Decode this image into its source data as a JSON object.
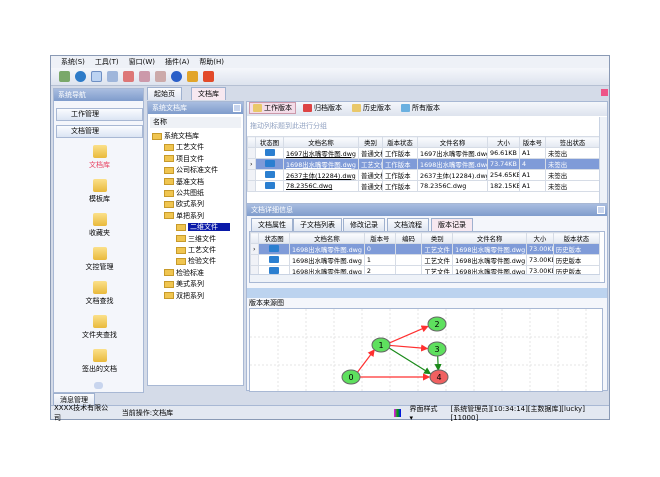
{
  "menu": [
    "系统(S)",
    "工具(T)",
    "窗口(W)",
    "插件(A)",
    "帮助(H)"
  ],
  "toolbar_icons": [
    "new-icon",
    "globe-icon",
    "window-icon",
    "layout-icon",
    "doc-red-icon",
    "doc-blue-icon",
    "doc-check-icon",
    "help-icon",
    "lock-icon",
    "power-icon"
  ],
  "nav": {
    "title": "系统导航",
    "groups": [
      "工作管理",
      "文档管理"
    ],
    "items": [
      {
        "label": "文档库",
        "active": true
      },
      {
        "label": "模板库"
      },
      {
        "label": "收藏夹"
      },
      {
        "label": "文控管理"
      },
      {
        "label": "文档查找"
      },
      {
        "label": "文件夹查找"
      },
      {
        "label": "签出的文档"
      }
    ]
  },
  "doc_tabs": [
    "起始页",
    "文档库"
  ],
  "tree": {
    "title": "系统文档库",
    "column": "名称",
    "nodes": [
      {
        "label": "系统文档库",
        "level": 0
      },
      {
        "label": "工艺文件",
        "level": 1
      },
      {
        "label": "项目文件",
        "level": 1
      },
      {
        "label": "公司标准文件",
        "level": 1
      },
      {
        "label": "基准文档",
        "level": 1
      },
      {
        "label": "公共图纸",
        "level": 1
      },
      {
        "label": "欧式系列",
        "level": 1
      },
      {
        "label": "单把系列",
        "level": 1
      },
      {
        "label": "二维文件",
        "level": 2,
        "selected": true
      },
      {
        "label": "三维文件",
        "level": 2
      },
      {
        "label": "工艺文件",
        "level": 2
      },
      {
        "label": "检验文件",
        "level": 2
      },
      {
        "label": "检验标准",
        "level": 1
      },
      {
        "label": "美式系列",
        "level": 1
      },
      {
        "label": "双把系列",
        "level": 1
      }
    ]
  },
  "version_toolbar": [
    "工作版本",
    "归档版本",
    "历史版本",
    "所有版本"
  ],
  "group_hint": "拖动列标题到此进行分组",
  "main_grid": {
    "columns": [
      "状态图",
      "文档名称",
      "类别",
      "版本状态",
      "文件名称",
      "大小",
      "版本号",
      "签出状态"
    ],
    "rows": [
      [
        "",
        "1697出水嘴零件图.dwg",
        "普通文档",
        "工作版本",
        "1697出水嘴零件图.dwg",
        "96.61KB",
        "A1",
        "未签出"
      ],
      [
        "",
        "1698出水嘴零件图.dwg",
        "工艺文件",
        "工作版本",
        "1698出水嘴零件图.dwg",
        "73.74KB",
        "4",
        "未签出"
      ],
      [
        "",
        "2637主体(12284).dwg",
        "普通文档",
        "工作版本",
        "2637主体(12284).dwg",
        "254.65KB",
        "A1",
        "未签出"
      ],
      [
        "",
        "78.2356C.dwg",
        "普通文档",
        "工作版本",
        "78.2356C.dwg",
        "182.15KB",
        "A1",
        "未签出"
      ]
    ],
    "selected": 1
  },
  "detail": {
    "title": "文档详细信息",
    "tabs": [
      "文档属性",
      "子文档列表",
      "修改记录",
      "文档流程",
      "版本记录"
    ],
    "active_tab": 4,
    "columns": [
      "状态图",
      "文档名称",
      "版本号",
      "编码",
      "类别",
      "文件名称",
      "大小",
      "版本状态"
    ],
    "rows": [
      [
        "",
        "1698出水嘴零件图.dwg",
        "0",
        "",
        "工艺文件",
        "1698出水嘴零件图.dwg",
        "73.00KB",
        "历史版本"
      ],
      [
        "",
        "1698出水嘴零件图.dwg",
        "1",
        "",
        "工艺文件",
        "1698出水嘴零件图.dwg",
        "73.00KB",
        "历史版本"
      ],
      [
        "",
        "1698出水嘴零件图.dwg",
        "2",
        "",
        "工艺文件",
        "1698出水嘴零件图.dwg",
        "73.00KB",
        "历史版本"
      ]
    ]
  },
  "graph": {
    "title": "版本来源图",
    "nodes": [
      {
        "id": "0",
        "color": "#5ee05e"
      },
      {
        "id": "1",
        "color": "#5ee05e"
      },
      {
        "id": "2",
        "color": "#5ee05e"
      },
      {
        "id": "3",
        "color": "#5ee05e"
      },
      {
        "id": "4",
        "color": "#f06060"
      }
    ],
    "edges": [
      {
        "from": "0",
        "to": "1",
        "color": "#ff3030"
      },
      {
        "from": "0",
        "to": "4",
        "color": "#ff3030"
      },
      {
        "from": "1",
        "to": "2",
        "color": "#ff3030"
      },
      {
        "from": "1",
        "to": "3",
        "color": "#ff3030"
      },
      {
        "from": "1",
        "to": "4",
        "color": "#1a8a1a"
      },
      {
        "from": "3",
        "to": "4",
        "color": "#1a8a1a"
      }
    ]
  },
  "bottom_tab": "消息管理",
  "status": {
    "company": "XXXX技术有限公司",
    "operation": "当前操作:文档库",
    "style": "界面样式",
    "info": "[系统管理员][10:34:14][主数据库][lucky][11000]"
  }
}
